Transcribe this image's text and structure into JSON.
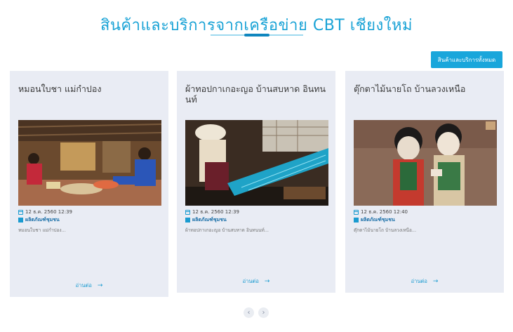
{
  "header": {
    "title": "สินค้าและบริการจากเครือข่าย CBT เชียงใหม่",
    "all_button_label": "สินค้าและบริการทั้งหมด"
  },
  "cards": [
    {
      "title": "หมอนใบชา แม่กำปอง",
      "date": "12 ธ.ค. 2560 12:39",
      "category": "ผลิตภัณฑ์ชุมชน",
      "excerpt": "หมอนใบชา แม่กำปอง...",
      "read_more": "อ่านต่อ",
      "image_icon": "handicraft-workshop-photo"
    },
    {
      "title": "ผ้าทอปกาเกอะญอ บ้านสบหาด อินทนนท์",
      "date": "12 ธ.ค. 2560 12:39",
      "category": "ผลิตภัณฑ์ชุมชน",
      "excerpt": "ผ้าทอปกาเกอะญอ บ้านสบหาด อินทนนท์...",
      "read_more": "อ่านต่อ",
      "image_icon": "weaving-loom-photo"
    },
    {
      "title": "ตุ๊กตาไม้นายโถ บ้านลวงเหนือ",
      "date": "12 ธ.ค. 2560 12:40",
      "category": "ผลิตภัณฑ์ชุมชน",
      "excerpt": "ตุ๊กตาไม้นายโถ บ้านลวงเหนือ...",
      "read_more": "อ่านต่อ",
      "image_icon": "wooden-dolls-photo"
    }
  ],
  "pager": {
    "prev": "‹",
    "next": "›"
  },
  "colors": {
    "accent": "#1aa3d6",
    "card_bg": "#e9ecf4"
  }
}
